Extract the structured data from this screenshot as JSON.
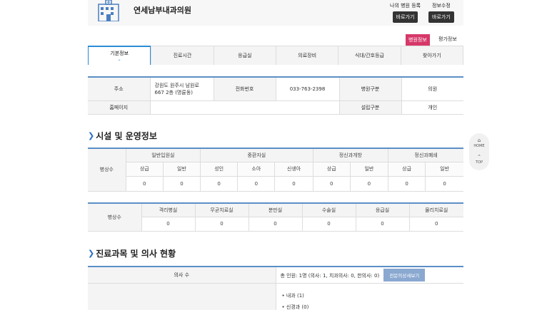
{
  "header": {
    "hospital_name": "연세남부내과의원",
    "register_label": "나의 병원 등록",
    "register_button": "바로가기",
    "edit_label": "정보수정",
    "edit_button": "바로가기"
  },
  "badges": {
    "hospital_info": "병원정보",
    "evaluation": "평가정보"
  },
  "tabs": [
    "기본정보",
    "진료시간",
    "응급실",
    "의료장비",
    "식대/간호등급",
    "찾아가기"
  ],
  "basic_info": {
    "address_label": "주소",
    "address_line1": "강원도 원주시 남원로",
    "address_line2": "667 2층 (명륜동)",
    "phone_label": "전화번호",
    "phone": "033-763-2398",
    "type_label": "병원구분",
    "type": "의원",
    "homepage_label": "홈페이지",
    "homepage": "",
    "founding_label": "설립구분",
    "founding": "개인"
  },
  "facilities": {
    "title": "시설 및 운영정보",
    "bed_label": "병상수",
    "groups": [
      "일반입원실",
      "중환자실",
      "정신과개방",
      "정신과폐쇄"
    ],
    "subheaders": [
      "상급",
      "일반",
      "성인",
      "소아",
      "신생아",
      "상급",
      "일반",
      "상급",
      "일반"
    ],
    "values": [
      "0",
      "0",
      "0",
      "0",
      "0",
      "0",
      "0",
      "0",
      "0"
    ],
    "bed_label2": "병상수",
    "rooms": [
      "격리병실",
      "무균치료실",
      "분만실",
      "수술실",
      "응급실",
      "물리치료실"
    ],
    "room_values": [
      "0",
      "0",
      "0",
      "0",
      "0",
      "0"
    ]
  },
  "doctors": {
    "title": "진료과목 및 의사 현황",
    "count_label": "의사 수",
    "total": "총 인원: 1명 (의사: 1, 치과의사: 0, 한의사: 0)",
    "specialist_button": "전문의상세보기",
    "subjects": [
      "내과 (1)",
      "신경과 (0)"
    ]
  },
  "float_menu": {
    "home": "HOME",
    "top": "TOP"
  }
}
